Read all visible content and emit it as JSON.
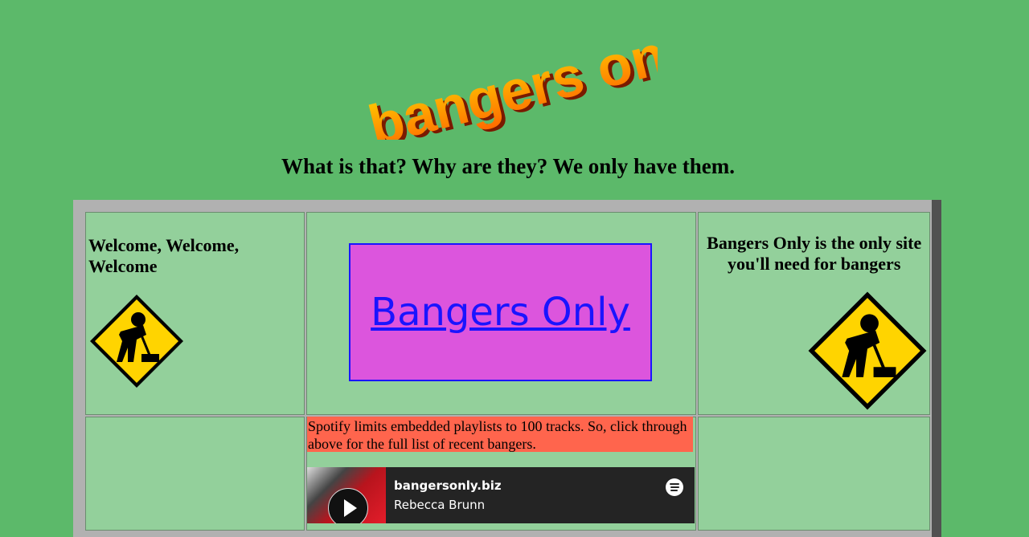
{
  "logo": {
    "text": "bangers only"
  },
  "tagline": "What is that? Why are they? We only have them.",
  "left_cell": {
    "welcome": "Welcome, Welcome, Welcome",
    "icon": "construction-worker-sign-icon"
  },
  "center_cell": {
    "link_label": "Bangers Only",
    "notice": "Spotify limits embedded playlists to 100 tracks. So, click through above for the full list of recent bangers."
  },
  "right_cell": {
    "text": "Bangers Only is the only site you'll need for bangers",
    "icon": "construction-worker-sign-icon"
  },
  "player": {
    "title": "bangersonly.biz",
    "artist": "Rebecca Brunn",
    "icon": "spotify-icon"
  },
  "colors": {
    "background": "#5cb96a",
    "cell": "#93d09b",
    "pink_box": "#dc55dd",
    "link": "#1a14ff",
    "notice": "#ff654d"
  }
}
